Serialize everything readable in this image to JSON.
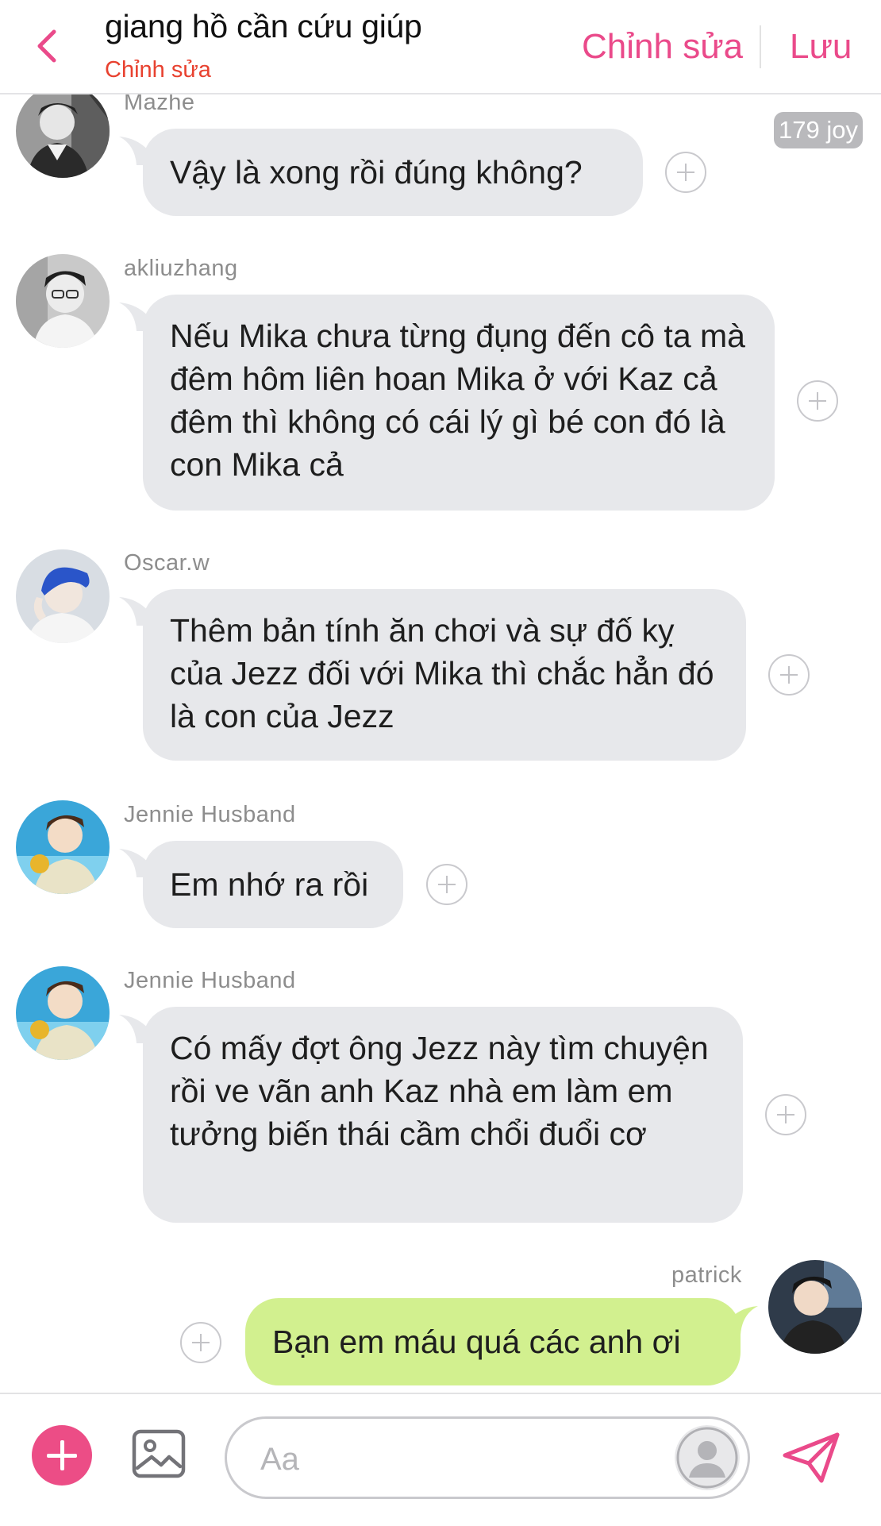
{
  "header": {
    "title": "giang hồ cần cứu giúp",
    "subtitle": "Chỉnh sửa",
    "edit_label": "Chỉnh sửa",
    "save_label": "Lưu",
    "accent": "#ea4a8a",
    "subtitle_color": "#e8412f"
  },
  "reaction_badge": "179 joy",
  "messages": [
    {
      "sender": "Mazhe",
      "text": "Vậy là xong rồi đúng không?",
      "mine": false
    },
    {
      "sender": "akliuzhang",
      "text": "Nếu Mika chưa từng đụng đến cô ta mà đêm hôm liên hoan Mika ở với Kaz cả đêm thì không có cái lý gì bé con đó là con Mika cả",
      "mine": false
    },
    {
      "sender": "Oscar.w",
      "text": "Thêm bản tính ăn chơi và sự đố kỵ của Jezz đối với Mika thì chắc hẳn đó là con của Jezz",
      "mine": false
    },
    {
      "sender": "Jennie Husband",
      "text": "Em nhớ ra rồi",
      "mine": false
    },
    {
      "sender": "Jennie Husband",
      "text": "Có mấy đợt ông Jezz này tìm chuyện rồi ve vãn anh Kaz nhà em làm em tưởng biến thái cầm chổi đuổi cơ",
      "mine": false
    },
    {
      "sender": "patrick",
      "text": "Bạn em máu quá các anh ơi",
      "mine": true
    }
  ],
  "composer": {
    "placeholder": "Aa",
    "add_icon": "plus-circle-icon",
    "image_icon": "image-icon",
    "send_icon": "send-icon"
  },
  "colors": {
    "bubble_other": "#e7e8eb",
    "bubble_mine": "#d2f08f",
    "plus_button": "#ec4d86"
  }
}
